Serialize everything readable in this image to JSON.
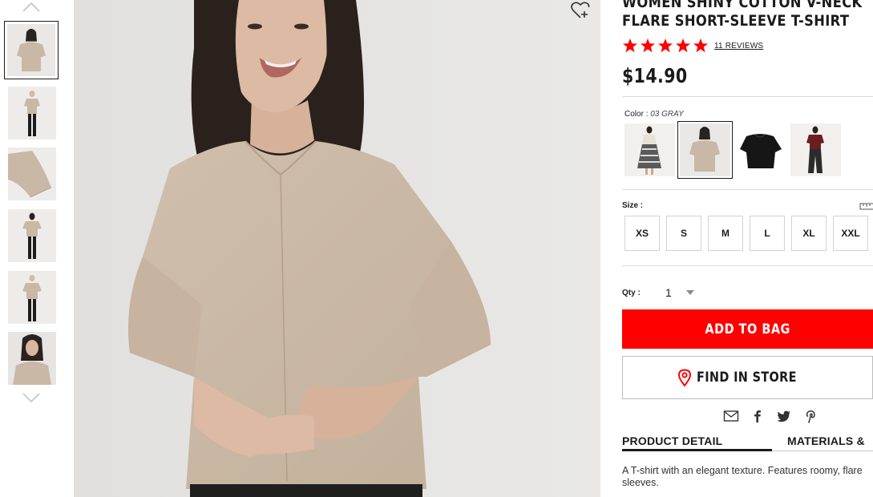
{
  "product": {
    "title_line1": "WOMEN SHINY COTTON V-NECK",
    "title_line2": "FLARE SHORT-SLEEVE T-SHIRT",
    "reviews_label": "11 REVIEWS",
    "rating": 5,
    "rating_max": 5,
    "price": "$14.90"
  },
  "color": {
    "label": "Color :",
    "selected_name": "03 GRAY",
    "swatches": [
      "outfit-with-floral-skirt",
      "gray-top",
      "black-top",
      "outfit-dark-red"
    ]
  },
  "size": {
    "label": "Size :",
    "options": [
      "XS",
      "S",
      "M",
      "L",
      "XL",
      "XXL"
    ]
  },
  "quantity": {
    "label": "Qty :",
    "value": "1"
  },
  "actions": {
    "add_to_bag": "ADD TO BAG",
    "find_in_store": "FIND IN STORE"
  },
  "tabs": {
    "product_detail": "PRODUCT DETAIL",
    "materials": "MATERIALS &"
  },
  "description": "A T-shirt with an elegant texture. Features roomy, flare sleeves.",
  "colors": {
    "accent_red": "#ff0000",
    "text": "#1b1b1b",
    "beige": "#c9b8a5"
  },
  "icons": [
    "chevron-up-icon",
    "chevron-down-icon",
    "heart-plus-icon",
    "star-icon",
    "location-pin-icon",
    "mail-icon",
    "facebook-icon",
    "twitter-icon",
    "pinterest-icon",
    "ruler-icon",
    "caret-down-icon"
  ]
}
